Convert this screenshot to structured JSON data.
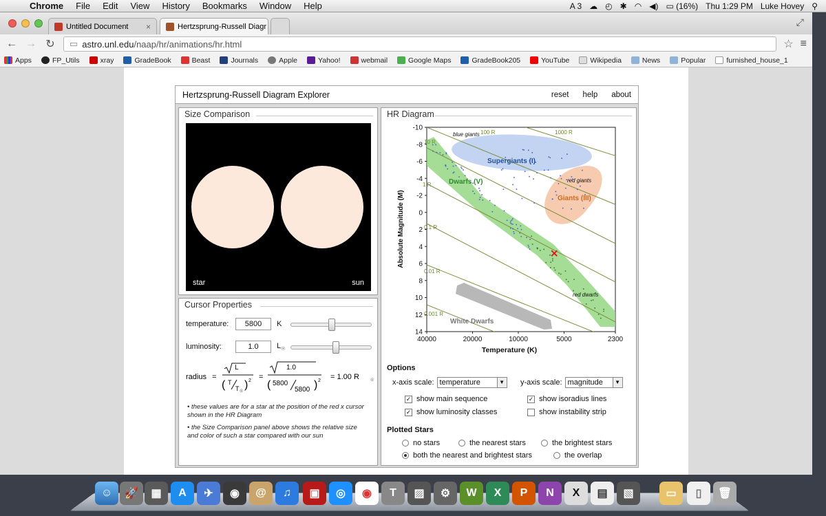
{
  "menubar": {
    "app": "Chrome",
    "items": [
      "File",
      "Edit",
      "View",
      "History",
      "Bookmarks",
      "Window",
      "Help"
    ],
    "status": {
      "battery": "(16%)",
      "clock": "Thu 1:29 PM",
      "user": "Luke Hovey",
      "badge": "3"
    }
  },
  "browser": {
    "tabs": [
      {
        "title": "Untitled Document"
      },
      {
        "title": "Hertzsprung-Russell Diagr"
      }
    ],
    "url_host": "astro.unl.edu",
    "url_path": "/naap/hr/animations/hr.html",
    "bookmarks": [
      "Apps",
      "FP_Utils",
      "xray",
      "GradeBook",
      "Beast",
      "Journals",
      "Apple",
      "Yahoo!",
      "webmail",
      "Google Maps",
      "GradeBook205",
      "YouTube",
      "Wikipedia",
      "News",
      "Popular",
      "furnished_house_1"
    ]
  },
  "app": {
    "title": "Hertzsprung-Russell Diagram Explorer",
    "links": {
      "reset": "reset",
      "help": "help",
      "about": "about"
    }
  },
  "size_comparison": {
    "title": "Size Comparison",
    "star_label": "star",
    "sun_label": "sun",
    "star_color": "#fde9dc"
  },
  "cursor": {
    "title": "Cursor Properties",
    "temp_label": "temperature:",
    "temp_value": "5800",
    "temp_unit": "K",
    "lum_label": "luminosity:",
    "lum_value": "1.0",
    "lum_unit": "L",
    "radius_label": "radius",
    "formula_L": "L",
    "formula_T": "T",
    "formula_lum": "1.0",
    "formula_t1": "5800",
    "formula_t2": "5800",
    "radius_result": "= 1.00 R",
    "note1": "• these values are for a star at the position of the red x cursor shown in the HR Diagram",
    "note2": "• the Size Comparison panel above shows the relative size and color of such a star compared with our sun",
    "temp_slider": 0.5,
    "lum_slider": 0.5
  },
  "hr": {
    "title": "HR Diagram",
    "xlabel": "Temperature (K)",
    "ylabel": "Absolute Magnitude (M)",
    "xticks": [
      "40000",
      "20000",
      "10000",
      "5000",
      "2300"
    ],
    "yticks": [
      "-10",
      "-8",
      "-6",
      "-4",
      "-2",
      "0",
      "2",
      "4",
      "6",
      "8",
      "10",
      "12",
      "14"
    ],
    "regions": {
      "supergiants": "Supergiants (I)",
      "blue_giants": "blue giants",
      "giants": "Giants (III)",
      "red_giants": "red giants",
      "dwarfs": "Dwarfs (V)",
      "red_dwarfs": "red dwarfs",
      "white_dwarfs": "White Dwarfs"
    },
    "iso": [
      "1000 R",
      "100 R",
      "10 R",
      "1 R",
      "0.1 R",
      "0.01 R",
      "0.001 R"
    ]
  },
  "chart_data": {
    "type": "scatter",
    "title": "HR Diagram",
    "xlabel": "Temperature (K)",
    "ylabel": "Absolute Magnitude (M)",
    "xlim": [
      40000,
      2300
    ],
    "ylim": [
      -10,
      14
    ],
    "cursor": {
      "temperature": 5800,
      "magnitude": 4.8
    }
  },
  "options": {
    "title": "Options",
    "xscale_label": "x-axis scale:",
    "xscale_value": "temperature",
    "yscale_label": "y-axis scale:",
    "yscale_value": "magnitude",
    "checks": [
      {
        "label": "show main sequence",
        "checked": true
      },
      {
        "label": "show isoradius lines",
        "checked": true
      },
      {
        "label": "show luminosity classes",
        "checked": true
      },
      {
        "label": "show instability strip",
        "checked": false
      }
    ]
  },
  "plotted": {
    "title": "Plotted Stars",
    "radios": [
      {
        "label": "no stars",
        "on": false
      },
      {
        "label": "the nearest stars",
        "on": false
      },
      {
        "label": "the brightest stars",
        "on": false
      },
      {
        "label": "both the nearest and brightest stars",
        "on": true
      },
      {
        "label": "the overlap",
        "on": false
      }
    ]
  },
  "colors": {
    "main_sequence": "#8fd47c",
    "supergiants": "#b9cdf0",
    "giants": "#f5c2a2",
    "white_dwarfs": "#b8b8b8",
    "iso_line": "#7c8f3a",
    "cursor": "#d62020"
  }
}
